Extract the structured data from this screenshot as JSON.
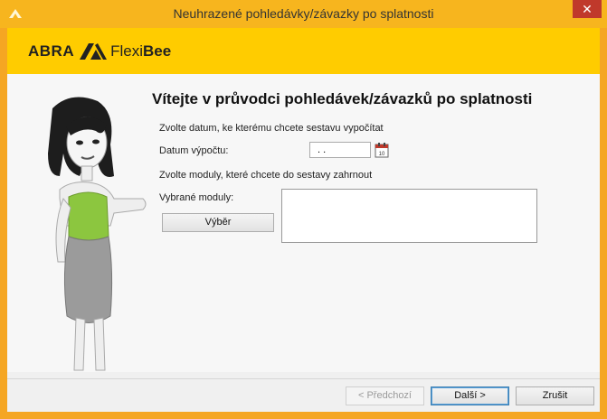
{
  "window": {
    "title": "Neuhrazené pohledávky/závazky po splatnosti",
    "close_label": "✕"
  },
  "brand": {
    "abra": "ABRA",
    "flexi": "Flexi",
    "bee": "Bee",
    "accent": "#ffcc00",
    "frame": "#f5a623"
  },
  "wizard": {
    "heading": "Vítejte v průvodci pohledávek/závazků po splatnosti",
    "date_instruction": "Zvolte datum, ke kterému chcete sestavu vypočítat",
    "date_label": "Datum výpočtu:",
    "date_value": " .  .",
    "modules_instruction": "Zvolte moduly, které chcete do sestavy zahrnout",
    "modules_label": "Vybrané moduly:",
    "select_button": "Výběr"
  },
  "footer": {
    "back": "< Předchozí",
    "next": "Další >",
    "cancel": "Zrušit"
  },
  "icons": {
    "app": "abra-app-icon",
    "calendar": "calendar-icon",
    "close": "close-icon",
    "illustration": "woman-illustration"
  }
}
